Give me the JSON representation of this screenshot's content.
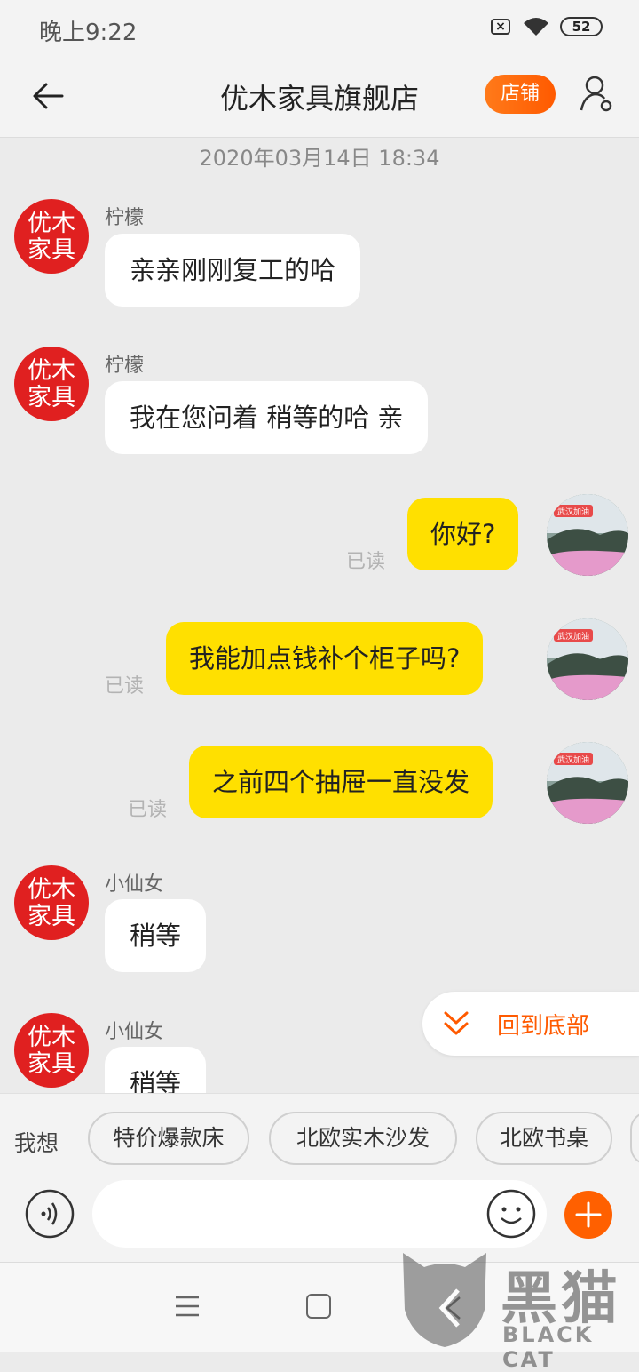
{
  "status_bar": {
    "time": "晚上9:22",
    "battery": "52",
    "sim_icon": "sim-error-icon",
    "wifi_icon": "wifi-icon"
  },
  "header": {
    "title": "优木家具旗舰店",
    "store_label": "店铺"
  },
  "chat": {
    "timestamp": "2020年03月14日 18:34",
    "messages": [
      {
        "side": "left",
        "sender": "柠檬",
        "text": "亲亲刚刚复工的哈"
      },
      {
        "side": "left",
        "sender": "柠檬",
        "text": "我在您问着 稍等的哈 亲"
      },
      {
        "side": "right",
        "text": "你好?",
        "status": "已读"
      },
      {
        "side": "right",
        "text": "我能加点钱补个柜子吗?",
        "status": "已读"
      },
      {
        "side": "right",
        "text": "之前四个抽屉一直没发",
        "status": "已读"
      },
      {
        "side": "left",
        "sender": "小仙女",
        "text": "稍等"
      },
      {
        "side": "left",
        "sender": "小仙女",
        "text": "稍等"
      }
    ],
    "shop_avatar_text": [
      "优木",
      "家具"
    ],
    "user_avatar_badge": "武汉加油"
  },
  "scroll_bottom": {
    "label": "回到底部"
  },
  "quick_chips": {
    "prefix": "我想",
    "items": [
      "特价爆款床",
      "北欧实木沙发",
      "北欧书桌"
    ]
  },
  "input": {
    "placeholder": ""
  },
  "watermark": {
    "title": "黑猫",
    "subtitle": "BLACK CAT"
  },
  "colors": {
    "accent": "#ff6000",
    "my_bubble": "#ffe000",
    "shop_avatar": "#e02020"
  }
}
